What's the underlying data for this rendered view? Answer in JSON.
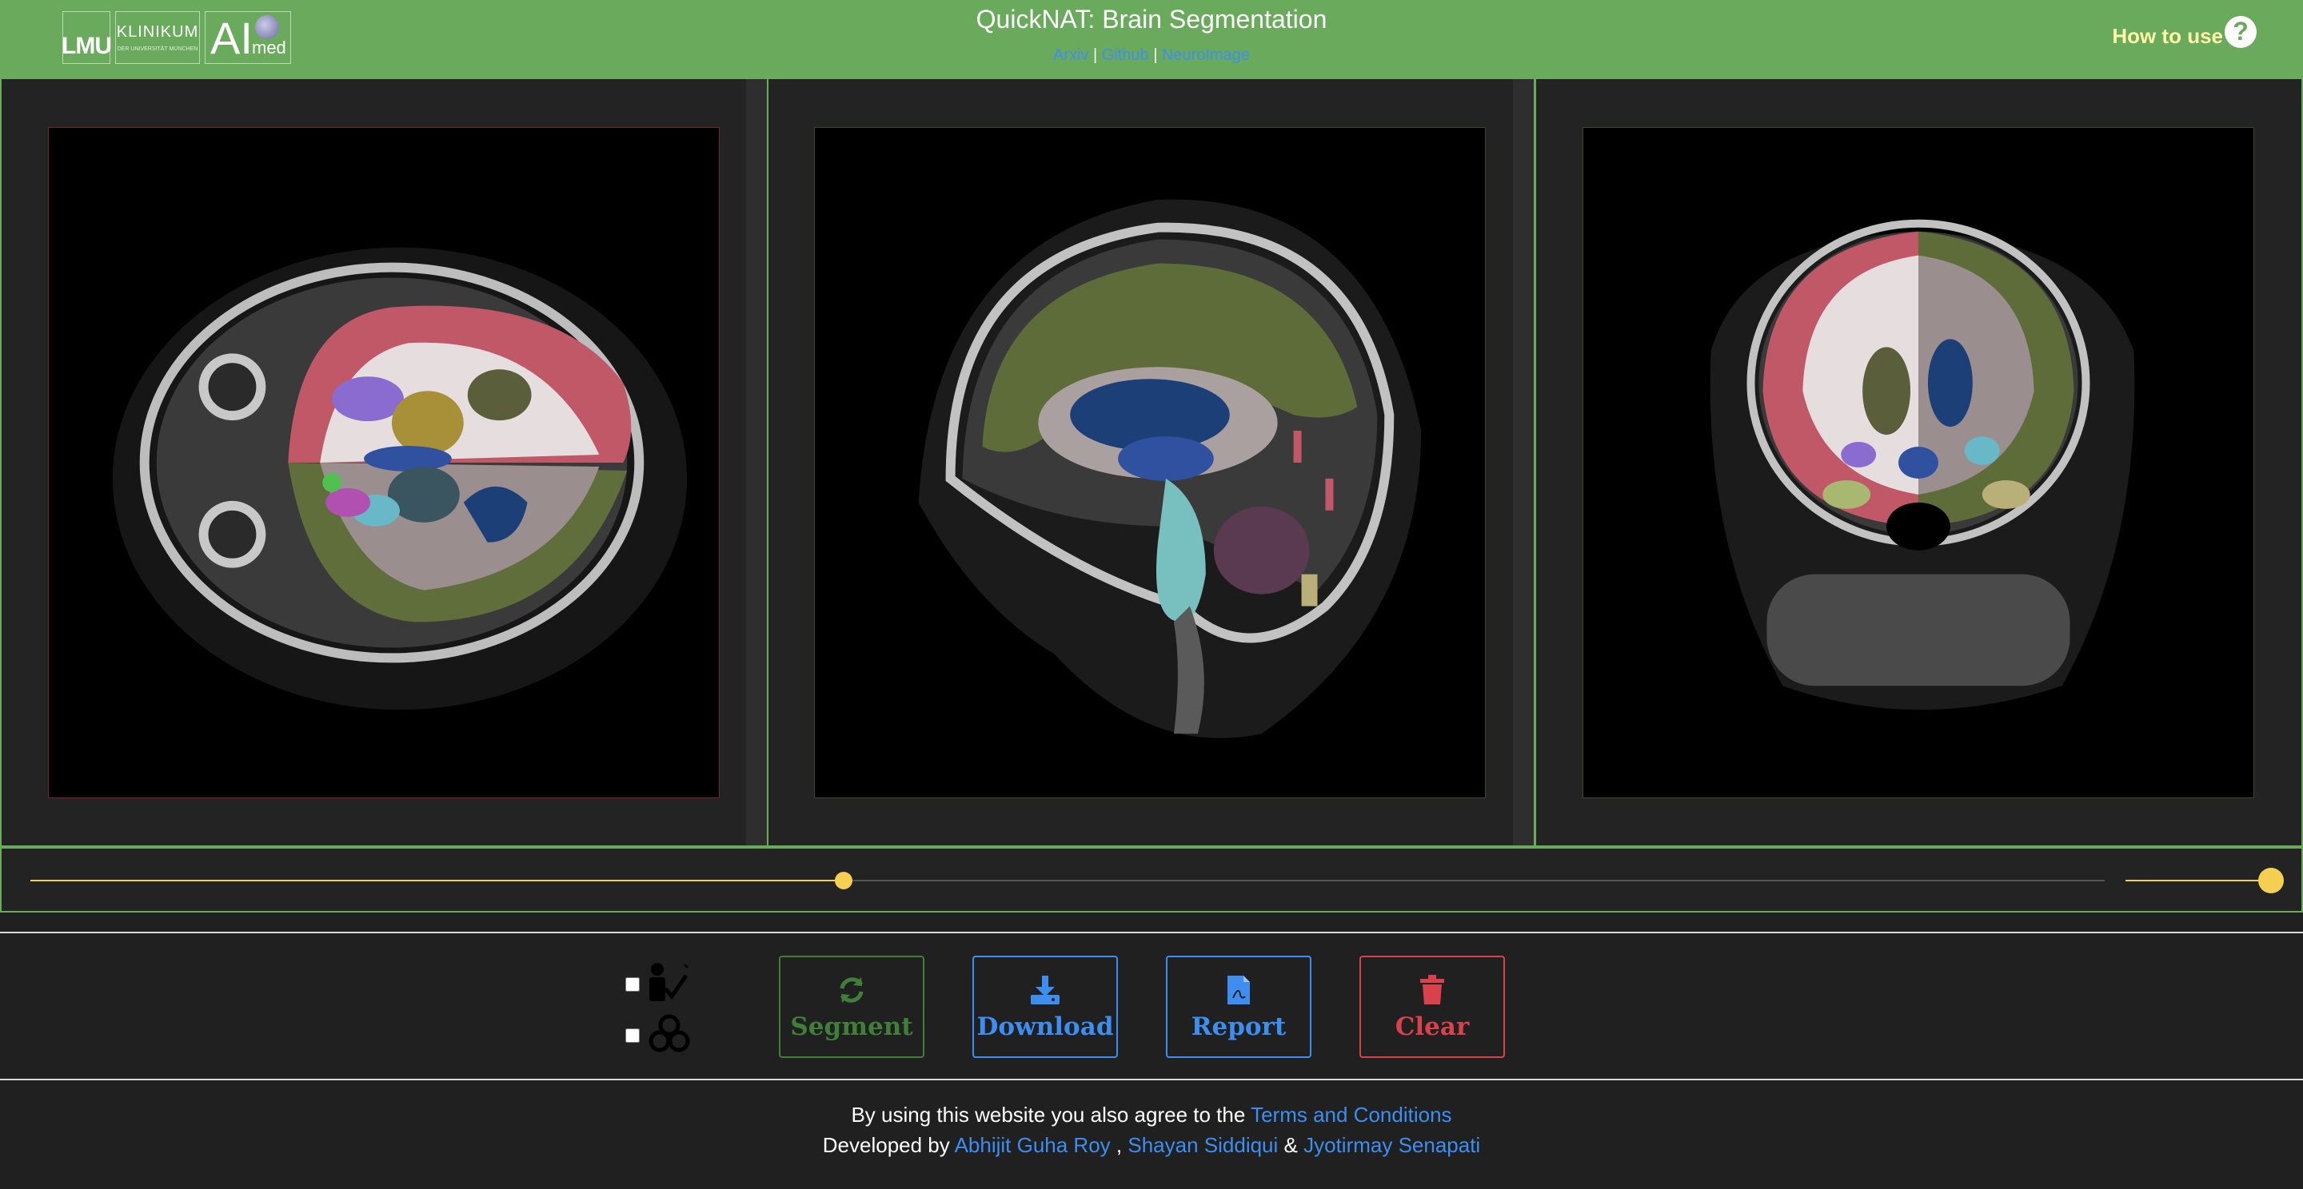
{
  "header": {
    "logos": {
      "lmu": "LMU",
      "klinikum": "KLINIKUM",
      "klinikum_sub": "DER UNIVERSITÄT MÜNCHEN",
      "ai": "AI",
      "med": "med"
    },
    "title": "QuickNAT: Brain Segmentation",
    "links": [
      "Arxiv",
      "Github",
      "NeuroImage"
    ],
    "separator": "|",
    "how_to_use": "How to use",
    "help_icon": "question-circle-icon"
  },
  "viewers": [
    {
      "name": "axial",
      "border_color": "#7a2030"
    },
    {
      "name": "sagittal",
      "border_color": "#3a4a20"
    },
    {
      "name": "coronal",
      "border_color": "#3a4a20"
    }
  ],
  "sliders": {
    "slice_position": 0.392,
    "opacity": 1.0
  },
  "controls": {
    "check_options": [
      {
        "icon": "manual-correction-icon",
        "checked": false
      },
      {
        "icon": "biohazard-icon",
        "checked": false
      }
    ],
    "buttons": {
      "segment": {
        "label": "Segment",
        "icon": "refresh-icon",
        "color": "#3f7f38"
      },
      "download": {
        "label": "Download",
        "icon": "download-icon",
        "color": "#3d8ef0"
      },
      "report": {
        "label": "Report",
        "icon": "pdf-file-icon",
        "color": "#3d8ef0"
      },
      "clear": {
        "label": "Clear",
        "icon": "trash-icon",
        "color": "#d9424c"
      }
    }
  },
  "footer": {
    "agree_text": "By using this website you also agree to the",
    "terms_link": "Terms and Conditions",
    "developed_by": "Developed by",
    "authors": [
      "Abhijit Guha Roy",
      "Shayan Siddiqui",
      "Jyotirmay Senapati"
    ],
    "sep_comma": ",",
    "sep_amp": "&"
  },
  "colors": {
    "header_bg": "#6aaa5c",
    "accent_yellow": "#f4cf52",
    "link_blue": "#3d8ef0"
  }
}
